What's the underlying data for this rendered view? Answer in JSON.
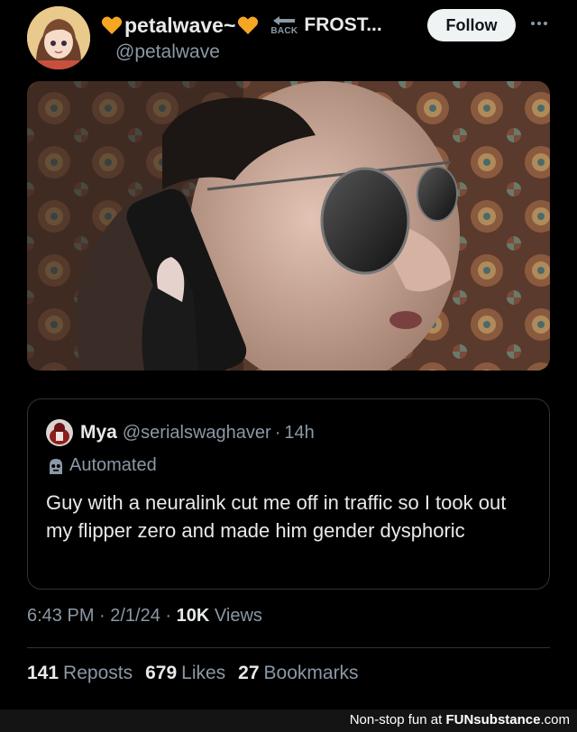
{
  "tweet": {
    "author": {
      "display_name": "petalwave~",
      "handle": "@petalwave",
      "back_label": "BACK",
      "secondary_name": "FROST..."
    },
    "follow_label": "Follow",
    "timestamp": "6:43 PM · 2/1/24 ·",
    "views_count": "10K",
    "views_label": "Views",
    "stats": [
      {
        "count": "141",
        "label": "Reposts"
      },
      {
        "count": "679",
        "label": "Likes"
      },
      {
        "count": "27",
        "label": "Bookmarks"
      }
    ]
  },
  "quoted": {
    "name": "Mya",
    "handle": "@serialswaghaver",
    "separator": "·",
    "time": "14h",
    "automated_label": "Automated",
    "text": "Guy with a neuralink cut me off in traffic so I took out my flipper zero and made him gender dysphoric"
  },
  "footer": {
    "prefix": "Non-stop fun at ",
    "brand": "FUNsubstance",
    "suffix": ".com"
  },
  "colors": {
    "background": "#000000",
    "text_primary": "#e7e9ea",
    "text_secondary": "#8b98a5",
    "border": "#2f3336",
    "heart": "#f5a623",
    "follow_bg": "#eff3f4"
  },
  "icons": [
    "orange-heart-icon",
    "back-arrow-icon",
    "more-dots-icon",
    "robot-icon"
  ]
}
